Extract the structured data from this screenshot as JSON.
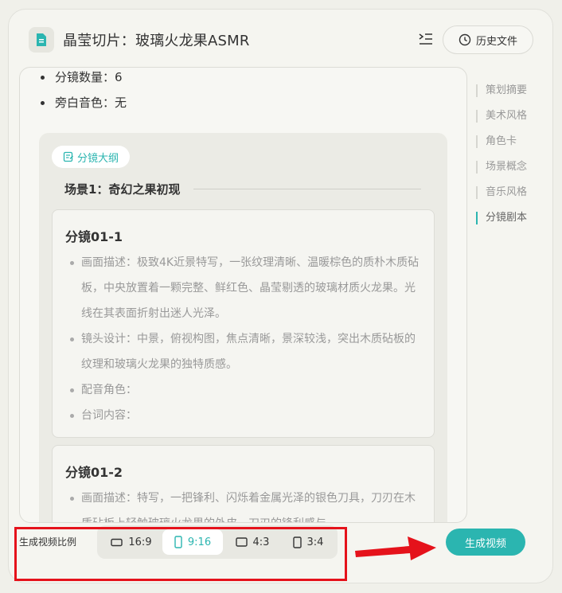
{
  "header": {
    "title": "晶莹切片：玻璃火龙果ASMR",
    "history_label": "历史文件"
  },
  "summary": {
    "items": [
      "分镜数量：6",
      "旁白音色：无"
    ]
  },
  "outline": {
    "tag": "分镜大纲",
    "scene_title": "场景1：奇幻之果初现",
    "cards": [
      {
        "title": "分镜01-1",
        "items": [
          "画面描述：极致4K近景特写，一张纹理清晰、温暖棕色的质朴木质砧板，中央放置着一颗完整、鲜红色、晶莹剔透的玻璃材质火龙果。光线在其表面折射出迷人光泽。",
          "镜头设计：中景，俯视构图，焦点清晰，景深较浅，突出木质砧板的纹理和玻璃火龙果的独特质感。",
          "配音角色：",
          "台词内容："
        ]
      },
      {
        "title": "分镜01-2",
        "items": [
          "画面描述：特写，一把锋利、闪烁着金属光泽的银色刀具，刀刃在木质砧板上轻触玻璃火龙果的外皮，刀刃的锋利感与"
        ]
      }
    ]
  },
  "toc": {
    "items": [
      "策划摘要",
      "美术风格",
      "角色卡",
      "场景概念",
      "音乐风格",
      "分镜剧本"
    ],
    "active_index": 5
  },
  "footer": {
    "ratio_label": "生成视频比例",
    "ratios": [
      "16:9",
      "9:16",
      "4:3",
      "3:4"
    ],
    "selected_ratio": "9:16",
    "generate_label": "生成视频"
  },
  "colors": {
    "accent": "#2bb5b0",
    "annotation": "#e5121b"
  }
}
